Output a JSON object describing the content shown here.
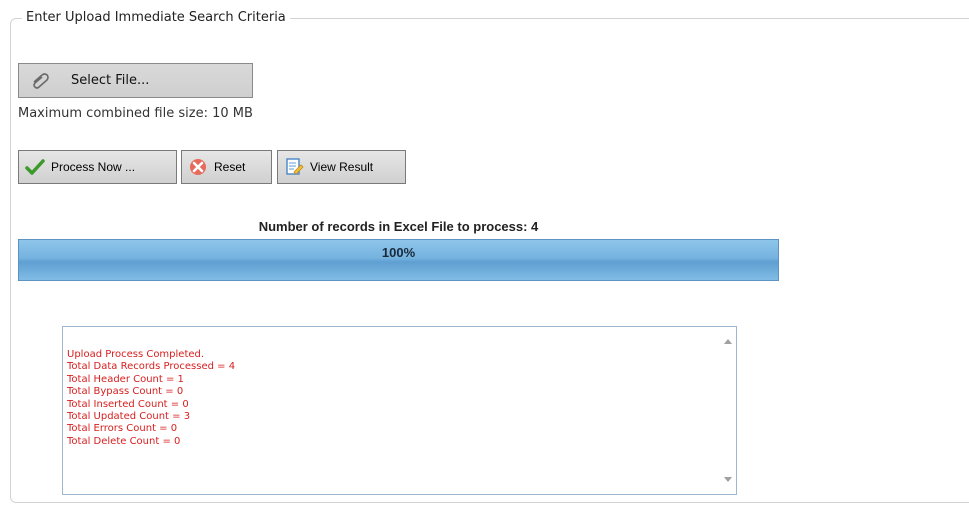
{
  "form": {
    "legend": "Enter Upload Immediate Search Criteria",
    "select_file_label": "Select File...",
    "max_size_text": "Maximum combined file size: 10 MB"
  },
  "buttons": {
    "process": "Process Now ...",
    "reset": "Reset",
    "view": "View Result"
  },
  "progress": {
    "title": "Number of records in Excel File to process: 4",
    "percent_text": "100%",
    "value": 1.0
  },
  "log": {
    "lines": [
      "Upload Process Completed.",
      "Total Data Records Processed = 4",
      "Total Header Count = 1",
      "Total Bypass Count = 0",
      "Total Inserted Count = 0",
      "Total Updated Count = 3",
      "Total Errors Count = 0",
      "Total Delete Count = 0"
    ]
  },
  "icons": {
    "select_file": "paperclip-icon",
    "process": "checkmark-icon",
    "reset": "red-x-icon",
    "view": "document-edit-icon"
  },
  "colors": {
    "log_text": "#d81e1e",
    "progress_bar": "#6aaad8"
  }
}
